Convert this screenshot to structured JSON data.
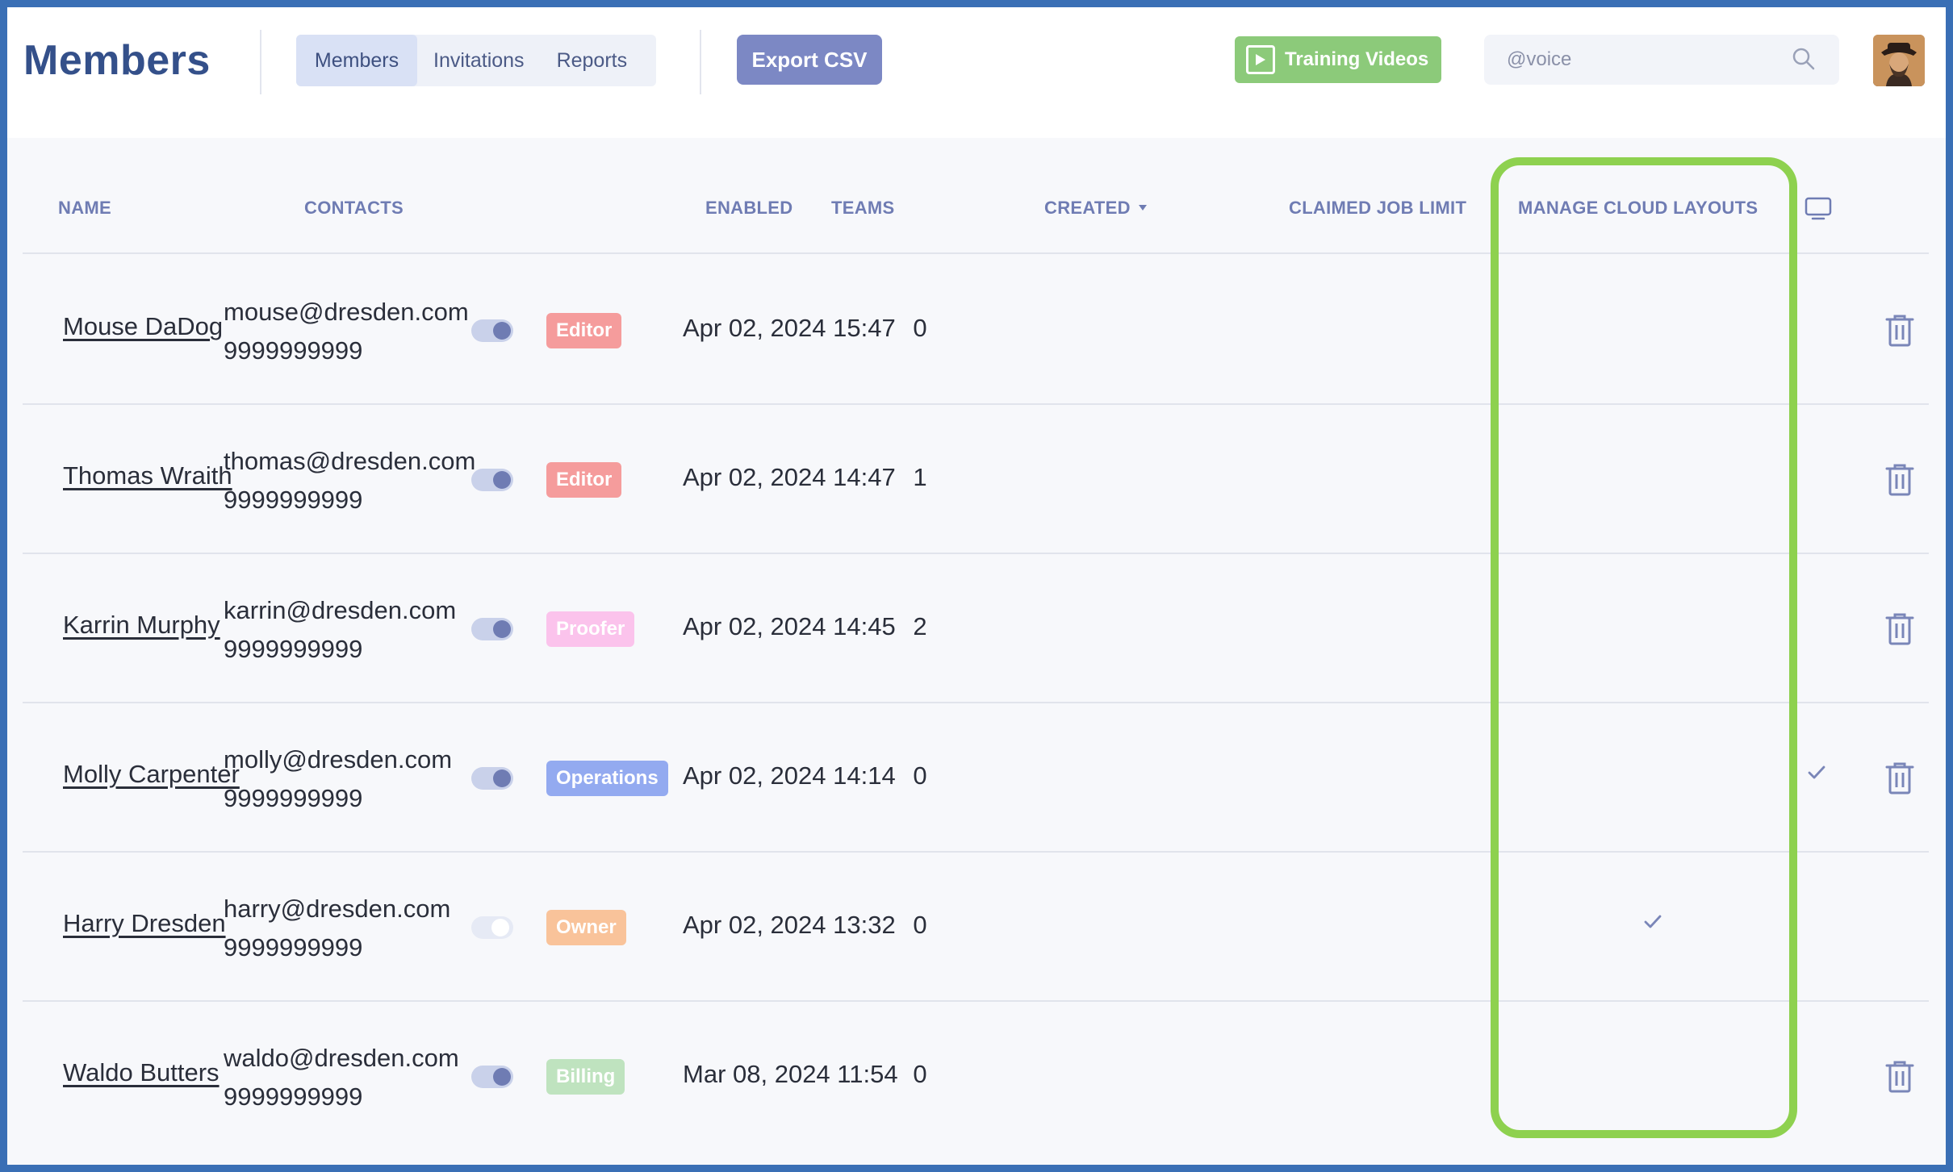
{
  "header": {
    "title": "Members",
    "tabs": [
      {
        "label": "Members",
        "active": true
      },
      {
        "label": "Invitations",
        "active": false
      },
      {
        "label": "Reports",
        "active": false
      }
    ],
    "export_label": "Export CSV",
    "training_label": "Training Videos",
    "search_value": "@voice"
  },
  "table": {
    "columns": {
      "name": "NAME",
      "contacts": "CONTACTS",
      "enabled": "ENABLED",
      "teams": "TEAMS",
      "created": "CREATED",
      "claimed_job_limit": "CLAIMED JOB LIMIT",
      "manage_cloud_layouts": "MANAGE CLOUD LAYOUTS"
    },
    "rows": [
      {
        "name": "Mouse DaDog",
        "email": "mouse@dresden.com",
        "phone": "9999999999",
        "enabled": true,
        "team": "Editor",
        "created": "Apr 02, 2024 15:47",
        "limit": "0",
        "manage_cloud_layouts": false,
        "last_col_check": false,
        "deletable": true
      },
      {
        "name": "Thomas Wraith",
        "email": "thomas@dresden.com",
        "phone": "9999999999",
        "enabled": true,
        "team": "Editor",
        "created": "Apr 02, 2024 14:47",
        "limit": "1",
        "manage_cloud_layouts": false,
        "last_col_check": false,
        "deletable": true
      },
      {
        "name": "Karrin Murphy",
        "email": "karrin@dresden.com",
        "phone": "9999999999",
        "enabled": true,
        "team": "Proofer",
        "created": "Apr 02, 2024 14:45",
        "limit": "2",
        "manage_cloud_layouts": false,
        "last_col_check": false,
        "deletable": true
      },
      {
        "name": "Molly Carpenter",
        "email": "molly@dresden.com",
        "phone": "9999999999",
        "enabled": true,
        "team": "Operations",
        "created": "Apr 02, 2024 14:14",
        "limit": "0",
        "manage_cloud_layouts": false,
        "last_col_check": true,
        "deletable": true
      },
      {
        "name": "Harry Dresden",
        "email": "harry@dresden.com",
        "phone": "9999999999",
        "enabled": false,
        "team": "Owner",
        "created": "Apr 02, 2024 13:32",
        "limit": "0",
        "manage_cloud_layouts": true,
        "last_col_check": false,
        "deletable": false
      },
      {
        "name": "Waldo Butters",
        "email": "waldo@dresden.com",
        "phone": "9999999999",
        "enabled": true,
        "team": "Billing",
        "created": "Mar 08, 2024 11:54",
        "limit": "0",
        "manage_cloud_layouts": false,
        "last_col_check": false,
        "deletable": true
      }
    ]
  },
  "colors": {
    "frame_border": "#3a6fb5",
    "title": "#34508a",
    "header_text": "#6f7cb3",
    "export_button": "#7c88c4",
    "training_button": "#8cca7a",
    "highlight": "#8ed14f",
    "badge_editor": "#f59c9c",
    "badge_proofer": "#fbc3ec",
    "badge_operations": "#93aaf0",
    "badge_owner": "#f9c39a",
    "badge_billing": "#bfe3bf"
  },
  "icons": {
    "play": "play-icon",
    "search": "search-icon",
    "sort": "sort-down-icon",
    "monitor": "monitor-icon",
    "check": "check-icon",
    "trash": "trash-icon"
  }
}
